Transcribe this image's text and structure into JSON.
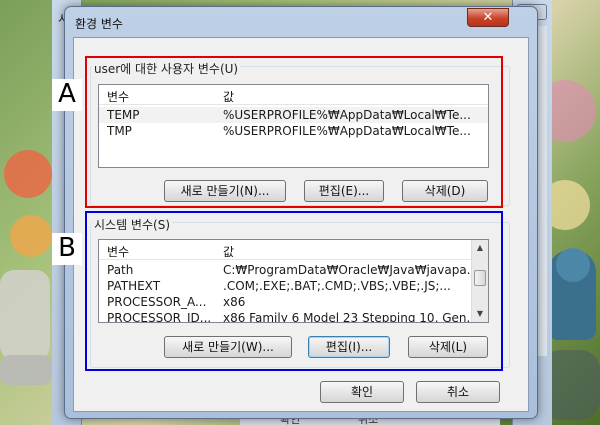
{
  "background": {
    "left_window_char": "시",
    "right_window_close": "x",
    "bottom_labels": [
      "확인",
      "취소"
    ]
  },
  "dialog": {
    "title": "환경 변수",
    "close_glyph": "✕"
  },
  "user_vars": {
    "group_label": "user에 대한 사용자 변수(U)",
    "columns": [
      "변수",
      "값"
    ],
    "rows": [
      {
        "name": "TEMP",
        "value": "%USERPROFILE%₩AppData₩Local₩Te..."
      },
      {
        "name": "TMP",
        "value": "%USERPROFILE%₩AppData₩Local₩Te..."
      }
    ],
    "buttons": {
      "new": "새로 만들기(N)...",
      "edit": "편집(E)...",
      "delete": "삭제(D)"
    }
  },
  "system_vars": {
    "group_label": "시스템 변수(S)",
    "columns": [
      "변수",
      "값"
    ],
    "rows": [
      {
        "name": "Path",
        "value": "C:₩ProgramData₩Oracle₩Java₩javapa..."
      },
      {
        "name": "PATHEXT",
        "value": ".COM;.EXE;.BAT;.CMD;.VBS;.VBE;.JS;..."
      },
      {
        "name": "PROCESSOR_A...",
        "value": "x86"
      },
      {
        "name": "PROCESSOR_ID...",
        "value": "x86 Family 6 Model 23 Stepping 10, Gen..."
      }
    ],
    "buttons": {
      "new": "새로 만들기(W)...",
      "edit": "편집(I)...",
      "delete": "삭제(L)"
    }
  },
  "footer": {
    "ok": "확인",
    "cancel": "취소"
  },
  "annotations": {
    "a_label": "A",
    "a_color": "#e00000",
    "b_label": "B",
    "b_color": "#0000e0"
  },
  "icons": {
    "scroll_up": "▲",
    "scroll_down": "▼"
  }
}
